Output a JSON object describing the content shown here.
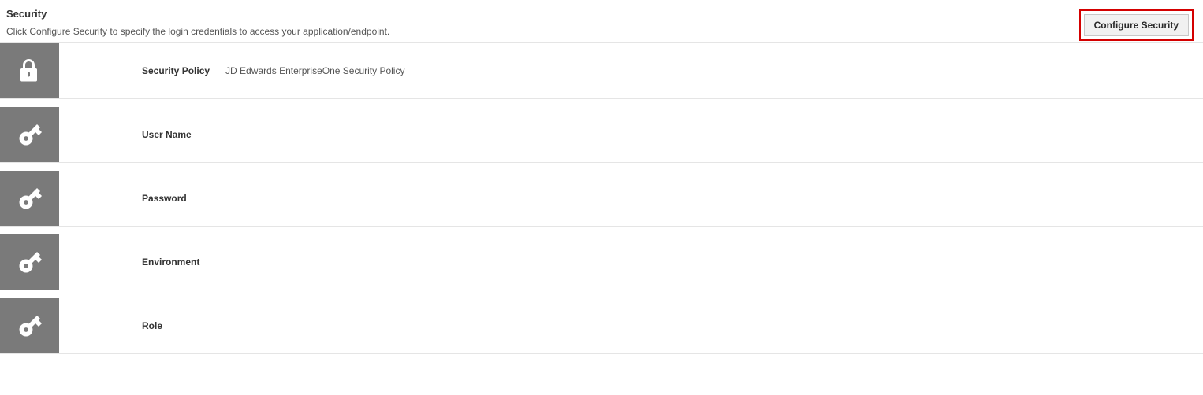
{
  "header": {
    "title": "Security",
    "description": "Click Configure Security to specify the login credentials to access your application/endpoint.",
    "button_label": "Configure Security"
  },
  "rows": {
    "security_policy": {
      "label": "Security Policy",
      "value": "JD Edwards EnterpriseOne Security Policy"
    },
    "username": {
      "label": "User Name",
      "value": ""
    },
    "password": {
      "label": "Password",
      "value": ""
    },
    "environment": {
      "label": "Environment",
      "value": ""
    },
    "role": {
      "label": "Role",
      "value": ""
    }
  }
}
